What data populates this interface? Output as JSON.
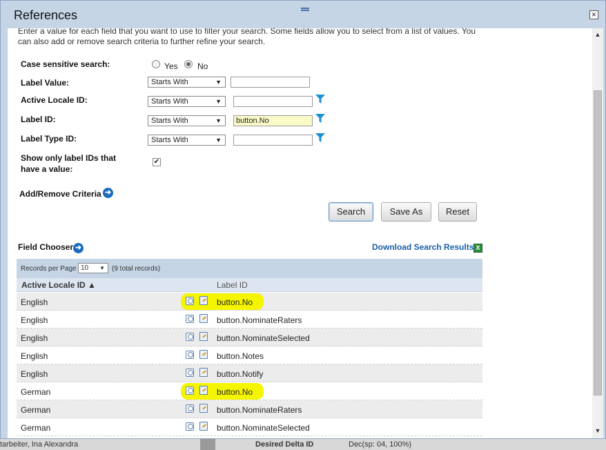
{
  "dialog": {
    "title": "References",
    "close_glyph": "×"
  },
  "intro": "Enter a value for each field that you want to use to filter your search. Some fields allow you to select from a list of values. You can also add or remove search criteria to further refine your search.",
  "form": {
    "case_sensitive": {
      "label": "Case sensitive search:",
      "yes": "Yes",
      "no": "No",
      "selected": "No"
    },
    "label_value": {
      "label": "Label Value:",
      "operator": "Starts With",
      "value": ""
    },
    "active_locale_id": {
      "label": "Active Locale ID:",
      "operator": "Starts With",
      "value": ""
    },
    "label_id": {
      "label": "Label ID:",
      "operator": "Starts With",
      "value": "button.No"
    },
    "label_type_id": {
      "label": "Label Type ID:",
      "operator": "Starts With",
      "value": ""
    },
    "show_only": {
      "label_line1": "Show only label IDs that",
      "label_line2": "have a value:",
      "checked": true,
      "check_glyph": "✔"
    },
    "add_remove": "Add/Remove Criteria"
  },
  "buttons": {
    "search": "Search",
    "save_as": "Save As",
    "reset": "Reset"
  },
  "field_chooser": "Field Chooser",
  "download": "Download Search Results",
  "grid": {
    "records_per_page_label": "Records per Page",
    "records_per_page": "10",
    "total": "(9 total records)",
    "columns": [
      "Active Locale ID ▲",
      "Label ID"
    ],
    "rows": [
      {
        "locale": "English",
        "label_id": "button.No",
        "highlight": true
      },
      {
        "locale": "English",
        "label_id": "button.NominateRaters",
        "highlight": false
      },
      {
        "locale": "English",
        "label_id": "button.NominateSelected",
        "highlight": false
      },
      {
        "locale": "English",
        "label_id": "button.Notes",
        "highlight": false
      },
      {
        "locale": "English",
        "label_id": "button.Notify",
        "highlight": false
      },
      {
        "locale": "German",
        "label_id": "button.No",
        "highlight": true
      },
      {
        "locale": "German",
        "label_id": "button.NominateRaters",
        "highlight": false
      },
      {
        "locale": "German",
        "label_id": "button.NominateSelected",
        "highlight": false
      }
    ]
  },
  "background": {
    "left_text": "tarbeiter, Ina Alexandra",
    "right_text": "Desired Delta ID",
    "far_text": "Dec(sp: 04, 100%)"
  },
  "colors": {
    "highlight": "#f5f500",
    "accent": "#1a5fa8",
    "header_bg": "#c5d5e6"
  },
  "icons": [
    "filter-icon",
    "arrow-right-circle-icon",
    "excel-icon",
    "view-icon",
    "edit-icon",
    "close-icon",
    "sort-ascending-icon"
  ]
}
